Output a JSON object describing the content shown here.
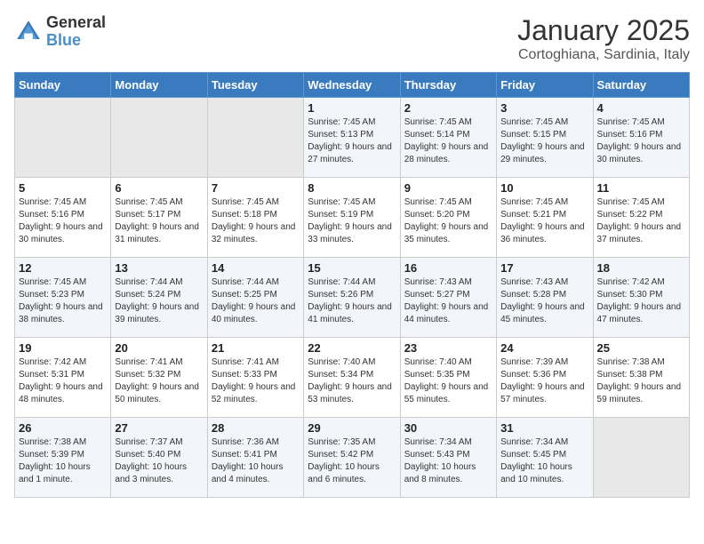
{
  "logo": {
    "line1": "General",
    "line2": "Blue"
  },
  "title": "January 2025",
  "location": "Cortoghiana, Sardinia, Italy",
  "days_of_week": [
    "Sunday",
    "Monday",
    "Tuesday",
    "Wednesday",
    "Thursday",
    "Friday",
    "Saturday"
  ],
  "weeks": [
    [
      {
        "day": "",
        "info": ""
      },
      {
        "day": "",
        "info": ""
      },
      {
        "day": "",
        "info": ""
      },
      {
        "day": "1",
        "info": "Sunrise: 7:45 AM\nSunset: 5:13 PM\nDaylight: 9 hours and 27 minutes."
      },
      {
        "day": "2",
        "info": "Sunrise: 7:45 AM\nSunset: 5:14 PM\nDaylight: 9 hours and 28 minutes."
      },
      {
        "day": "3",
        "info": "Sunrise: 7:45 AM\nSunset: 5:15 PM\nDaylight: 9 hours and 29 minutes."
      },
      {
        "day": "4",
        "info": "Sunrise: 7:45 AM\nSunset: 5:16 PM\nDaylight: 9 hours and 30 minutes."
      }
    ],
    [
      {
        "day": "5",
        "info": "Sunrise: 7:45 AM\nSunset: 5:16 PM\nDaylight: 9 hours and 30 minutes."
      },
      {
        "day": "6",
        "info": "Sunrise: 7:45 AM\nSunset: 5:17 PM\nDaylight: 9 hours and 31 minutes."
      },
      {
        "day": "7",
        "info": "Sunrise: 7:45 AM\nSunset: 5:18 PM\nDaylight: 9 hours and 32 minutes."
      },
      {
        "day": "8",
        "info": "Sunrise: 7:45 AM\nSunset: 5:19 PM\nDaylight: 9 hours and 33 minutes."
      },
      {
        "day": "9",
        "info": "Sunrise: 7:45 AM\nSunset: 5:20 PM\nDaylight: 9 hours and 35 minutes."
      },
      {
        "day": "10",
        "info": "Sunrise: 7:45 AM\nSunset: 5:21 PM\nDaylight: 9 hours and 36 minutes."
      },
      {
        "day": "11",
        "info": "Sunrise: 7:45 AM\nSunset: 5:22 PM\nDaylight: 9 hours and 37 minutes."
      }
    ],
    [
      {
        "day": "12",
        "info": "Sunrise: 7:45 AM\nSunset: 5:23 PM\nDaylight: 9 hours and 38 minutes."
      },
      {
        "day": "13",
        "info": "Sunrise: 7:44 AM\nSunset: 5:24 PM\nDaylight: 9 hours and 39 minutes."
      },
      {
        "day": "14",
        "info": "Sunrise: 7:44 AM\nSunset: 5:25 PM\nDaylight: 9 hours and 40 minutes."
      },
      {
        "day": "15",
        "info": "Sunrise: 7:44 AM\nSunset: 5:26 PM\nDaylight: 9 hours and 41 minutes."
      },
      {
        "day": "16",
        "info": "Sunrise: 7:43 AM\nSunset: 5:27 PM\nDaylight: 9 hours and 44 minutes."
      },
      {
        "day": "17",
        "info": "Sunrise: 7:43 AM\nSunset: 5:28 PM\nDaylight: 9 hours and 45 minutes."
      },
      {
        "day": "18",
        "info": "Sunrise: 7:42 AM\nSunset: 5:30 PM\nDaylight: 9 hours and 47 minutes."
      }
    ],
    [
      {
        "day": "19",
        "info": "Sunrise: 7:42 AM\nSunset: 5:31 PM\nDaylight: 9 hours and 48 minutes."
      },
      {
        "day": "20",
        "info": "Sunrise: 7:41 AM\nSunset: 5:32 PM\nDaylight: 9 hours and 50 minutes."
      },
      {
        "day": "21",
        "info": "Sunrise: 7:41 AM\nSunset: 5:33 PM\nDaylight: 9 hours and 52 minutes."
      },
      {
        "day": "22",
        "info": "Sunrise: 7:40 AM\nSunset: 5:34 PM\nDaylight: 9 hours and 53 minutes."
      },
      {
        "day": "23",
        "info": "Sunrise: 7:40 AM\nSunset: 5:35 PM\nDaylight: 9 hours and 55 minutes."
      },
      {
        "day": "24",
        "info": "Sunrise: 7:39 AM\nSunset: 5:36 PM\nDaylight: 9 hours and 57 minutes."
      },
      {
        "day": "25",
        "info": "Sunrise: 7:38 AM\nSunset: 5:38 PM\nDaylight: 9 hours and 59 minutes."
      }
    ],
    [
      {
        "day": "26",
        "info": "Sunrise: 7:38 AM\nSunset: 5:39 PM\nDaylight: 10 hours and 1 minute."
      },
      {
        "day": "27",
        "info": "Sunrise: 7:37 AM\nSunset: 5:40 PM\nDaylight: 10 hours and 3 minutes."
      },
      {
        "day": "28",
        "info": "Sunrise: 7:36 AM\nSunset: 5:41 PM\nDaylight: 10 hours and 4 minutes."
      },
      {
        "day": "29",
        "info": "Sunrise: 7:35 AM\nSunset: 5:42 PM\nDaylight: 10 hours and 6 minutes."
      },
      {
        "day": "30",
        "info": "Sunrise: 7:34 AM\nSunset: 5:43 PM\nDaylight: 10 hours and 8 minutes."
      },
      {
        "day": "31",
        "info": "Sunrise: 7:34 AM\nSunset: 5:45 PM\nDaylight: 10 hours and 10 minutes."
      },
      {
        "day": "",
        "info": ""
      }
    ]
  ]
}
